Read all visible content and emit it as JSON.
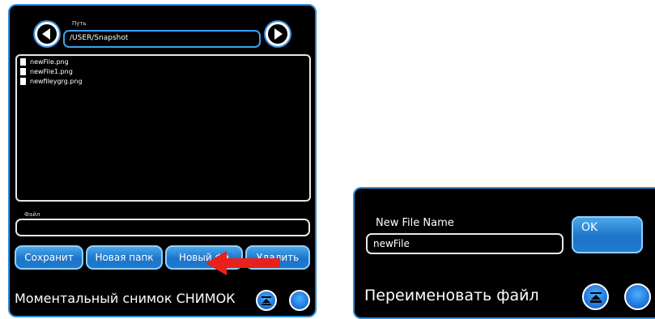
{
  "save_dialog": {
    "path_label": "Путь",
    "path_value": "/USER/Snapshot",
    "files": [
      "newFile.png",
      "newFile1.png",
      "newfileygrg.png"
    ],
    "file_label": "Файл",
    "file_value": "",
    "buttons": {
      "save": "Сохранит",
      "new_folder": "Новая папк",
      "new_file": "Новый фа",
      "delete": "Удалить"
    },
    "title": "Моментальный снимок СНИМОК"
  },
  "rename_dialog": {
    "name_label": "New File Name",
    "name_value": "newFile",
    "ok_label": "OK",
    "title": "Переименовать файл"
  },
  "colors": {
    "accent": "#2e8bd8",
    "button": "#1d74c9",
    "arrow": "#e8211d"
  }
}
